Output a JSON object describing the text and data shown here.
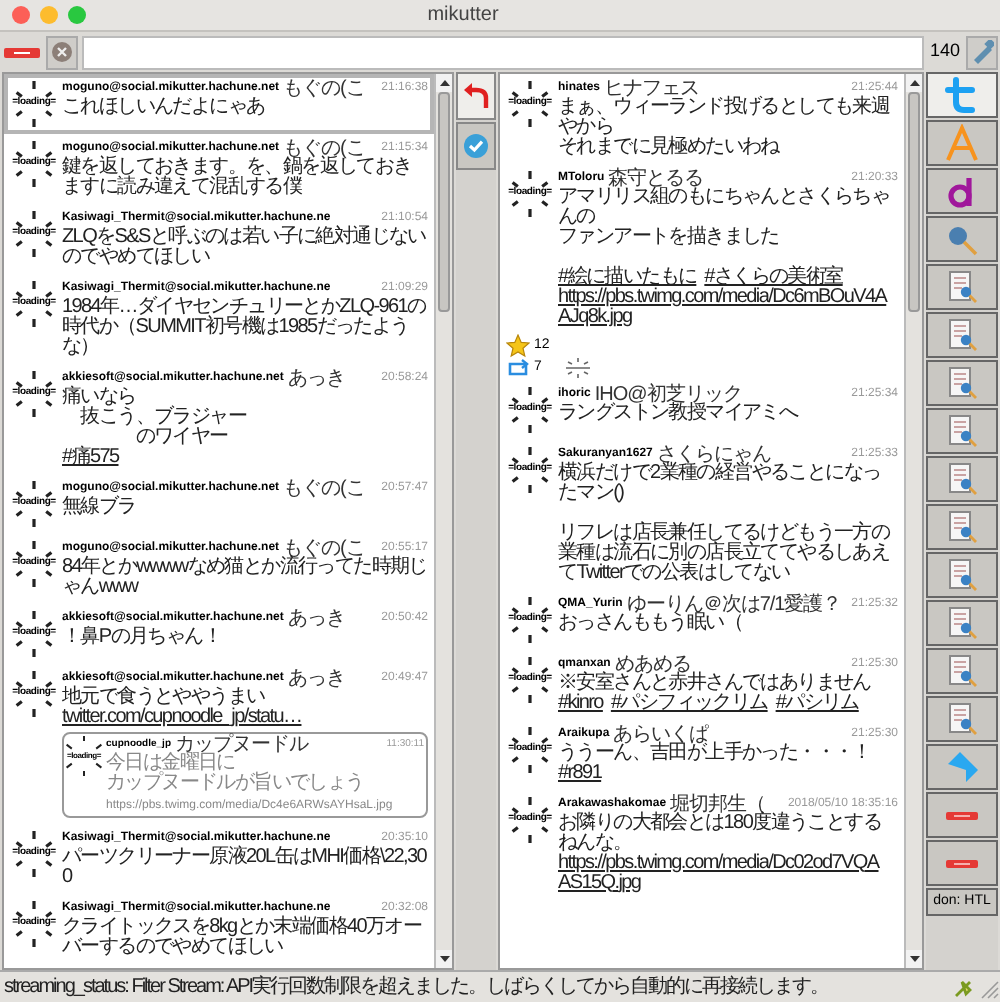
{
  "window": {
    "title": "mikutter"
  },
  "toolbar": {
    "counter": "140"
  },
  "left_tabs": [
    {
      "kind": "reply",
      "selected": true
    },
    {
      "kind": "badge",
      "selected": false
    }
  ],
  "left_timeline": {
    "items": [
      {
        "user": "moguno@social.mikutter.hachune.net",
        "display_name": "もぐの(こ",
        "time": "21:16:38",
        "avatar_label": "=loading=",
        "selected": true,
        "body": [
          {
            "kind": "text",
            "text": "これほしいんだよにゃあ"
          }
        ]
      },
      {
        "user": "moguno@social.mikutter.hachune.net",
        "display_name": "もぐの(こ",
        "time": "21:15:34",
        "avatar_label": "=loading=",
        "selected": false,
        "body": [
          {
            "kind": "text",
            "text": "鍵を返しておきます。を、鍋を返しておきますに読み違えて混乱する僕"
          }
        ]
      },
      {
        "user": "Kasiwagi_Thermit@social.mikutter.hachune.ne",
        "time": "21:10:54",
        "avatar_label": "=loading=",
        "selected": false,
        "body": [
          {
            "kind": "text",
            "text": "ZLQをS&Sと呼ぶのは若い子に絶対通じないのでやめてほしい"
          }
        ]
      },
      {
        "user": "Kasiwagi_Thermit@social.mikutter.hachune.ne",
        "time": "21:09:29",
        "avatar_label": "=loading=",
        "selected": false,
        "body": [
          {
            "kind": "text",
            "text": "1984年…ダイヤセンチュリーとかZLQ-961の時代か（SUMMIT初号機は1985だったような）"
          }
        ]
      },
      {
        "user": "akkiesoft@social.mikutter.hachune.net",
        "display_name": "あっき",
        "time": "20:58:24",
        "avatar_label": "=loading=",
        "selected": false,
        "body": [
          {
            "kind": "text",
            "text": "痛いなら"
          },
          {
            "kind": "break"
          },
          {
            "kind": "text",
            "text": "　抜こう、ブラジャー"
          },
          {
            "kind": "break"
          },
          {
            "kind": "text",
            "text": "　　　　のワイヤー"
          },
          {
            "kind": "break"
          },
          {
            "kind": "link",
            "text": "#痛575"
          }
        ]
      },
      {
        "user": "moguno@social.mikutter.hachune.net",
        "display_name": "もぐの(こ",
        "time": "20:57:47",
        "avatar_label": "=loading=",
        "selected": false,
        "body": [
          {
            "kind": "text",
            "text": "無線ブラ"
          }
        ]
      },
      {
        "user": "moguno@social.mikutter.hachune.net",
        "display_name": "もぐの(こ",
        "time": "20:55:17",
        "avatar_label": "=loading=",
        "selected": false,
        "body": [
          {
            "kind": "text",
            "text": "84年とかwwwwなめ猫とか流行ってた時期じゃんwww"
          }
        ]
      },
      {
        "user": "akkiesoft@social.mikutter.hachune.net",
        "display_name": "あっき",
        "time": "20:50:42",
        "avatar_label": "=loading=",
        "selected": false,
        "body": [
          {
            "kind": "text",
            "text": "！鼻Pの月ちゃん！"
          }
        ]
      },
      {
        "user": "akkiesoft@social.mikutter.hachune.net",
        "display_name": "あっき",
        "time": "20:49:47",
        "avatar_label": "=loading=",
        "selected": false,
        "body": [
          {
            "kind": "text",
            "text": "地元で食うとややうまい "
          },
          {
            "kind": "link",
            "text": "twitter.com/cupnoodle_jp/statu…"
          }
        ],
        "quote": {
          "user": "cupnoodle_jp",
          "display_name": "カップヌードル",
          "time": "11:30:11",
          "avatar_label": "=loading=",
          "body": [
            {
              "kind": "text",
              "text": "今日は金曜日に"
            },
            {
              "kind": "break"
            },
            {
              "kind": "text",
              "text": "カップヌードルが旨いでしょう"
            },
            {
              "kind": "url",
              "text": "https://pbs.twimg.com/media/Dc4e6ARWsAYHsaL.jpg"
            }
          ]
        }
      },
      {
        "user": "Kasiwagi_Thermit@social.mikutter.hachune.ne",
        "time": "20:35:10",
        "avatar_label": "=loading=",
        "selected": false,
        "body": [
          {
            "kind": "text",
            "text": "パーツクリーナー原液20L缶はMHI価格\\22,300"
          }
        ]
      },
      {
        "user": "Kasiwagi_Thermit@social.mikutter.hachune.ne",
        "time": "20:32:08",
        "avatar_label": "=loading=",
        "selected": false,
        "body": [
          {
            "kind": "text",
            "text": "クライトックスを8kgとか末端価格40万オーバーするのでやめてほしい"
          }
        ]
      }
    ]
  },
  "main_timeline": {
    "items": [
      {
        "user": "hinates",
        "display_name": "ヒナフェス",
        "time": "21:25:44",
        "avatar_label": "=loading=",
        "body": [
          {
            "kind": "text",
            "text": "まぁ、ウィーランド投げるとしても来週やから"
          },
          {
            "kind": "break"
          },
          {
            "kind": "text",
            "text": "それまでに見極めたいわね"
          }
        ]
      },
      {
        "user": "MToloru",
        "display_name": "森守とるる",
        "time": "21:20:33",
        "avatar_label": "=loading=",
        "body": [
          {
            "kind": "text",
            "text": "アマリリス組のもにちゃんとさくらちゃんの"
          },
          {
            "kind": "break"
          },
          {
            "kind": "text",
            "text": "ファンアートを描きました"
          },
          {
            "kind": "break"
          },
          {
            "kind": "break"
          },
          {
            "kind": "link",
            "text": "#絵に描いたもに"
          },
          {
            "kind": "link",
            "text": "#さくらの美術室"
          },
          {
            "kind": "link",
            "text": "https://pbs.twimg.com/media/Dc6mBOuV4AAJq8k.jpg"
          }
        ],
        "favorites": "12",
        "retweets": "7"
      },
      {
        "user": "ihoric",
        "display_name": "IHO@初芝リック",
        "time": "21:25:34",
        "avatar_label": "=loading=",
        "body": [
          {
            "kind": "text",
            "text": "ラングストン教授マイアミへ"
          }
        ]
      },
      {
        "user": "Sakuranyan1627",
        "display_name": "さくらにゃん",
        "time": "21:25:33",
        "avatar_label": "=loading=",
        "body": [
          {
            "kind": "text",
            "text": "横浜だけで2業種の経営やることになったマン()"
          },
          {
            "kind": "break"
          },
          {
            "kind": "break"
          },
          {
            "kind": "text",
            "text": "リフレは店長兼任してるけどもう一方の業種は流石に別の店長立ててやるしあえてTwitterでの公表はしてない"
          }
        ]
      },
      {
        "user": "QMA_Yurin",
        "display_name": "ゆーりん＠次は7/1愛護？",
        "time": "21:25:32",
        "avatar_label": "=loading=",
        "body": [
          {
            "kind": "text",
            "text": "おっさんももう眠い（"
          }
        ]
      },
      {
        "user": "qmanxan",
        "display_name": "めあめる",
        "time": "21:25:30",
        "avatar_label": "=loading=",
        "body": [
          {
            "kind": "text",
            "text": "※安室さんと赤井さんではありません "
          },
          {
            "kind": "link",
            "text": "#kinro"
          },
          {
            "kind": "link",
            "text": "#パシフィックリム"
          },
          {
            "kind": "link",
            "text": "#パシリム"
          }
        ]
      },
      {
        "user": "Araikupa",
        "display_name": "あらいくぱ",
        "time": "21:25:30",
        "avatar_label": "=loading=",
        "body": [
          {
            "kind": "text",
            "text": "ううーん、吉田が上手かった・・・！ "
          },
          {
            "kind": "link",
            "text": "#r891"
          }
        ]
      },
      {
        "user": "Arakawashakomae",
        "display_name": "堀切邦生（",
        "time": "2018/05/10 18:35:16",
        "avatar_label": "=loading=",
        "body": [
          {
            "kind": "text",
            "text": "お隣りの大都会とは180度違うことするねんな。 "
          },
          {
            "kind": "link",
            "text": "https://pbs.twimg.com/media/Dc02od7VQAAS15Q.jpg"
          }
        ]
      }
    ]
  },
  "side_tabs": [
    {
      "kind": "t-logo",
      "selected": true
    },
    {
      "kind": "a-logo",
      "selected": false
    },
    {
      "kind": "d-logo",
      "selected": false
    },
    {
      "kind": "search",
      "selected": false
    },
    {
      "kind": "list",
      "selected": false
    },
    {
      "kind": "list",
      "selected": false
    },
    {
      "kind": "list",
      "selected": false
    },
    {
      "kind": "list",
      "selected": false
    },
    {
      "kind": "list",
      "selected": false
    },
    {
      "kind": "list",
      "selected": false
    },
    {
      "kind": "list",
      "selected": false
    },
    {
      "kind": "list",
      "selected": false
    },
    {
      "kind": "list",
      "selected": false
    },
    {
      "kind": "list",
      "selected": false
    },
    {
      "kind": "ribbon",
      "selected": false
    },
    {
      "kind": "bar",
      "selected": false
    },
    {
      "kind": "bar",
      "selected": false
    },
    {
      "kind": "label",
      "label": "don: HTL",
      "selected": false
    }
  ],
  "status_bar": {
    "text": "streaming_status: Filter Stream: API実行回数制限を超えました。しばらくしてから自動的に再接続します。"
  }
}
